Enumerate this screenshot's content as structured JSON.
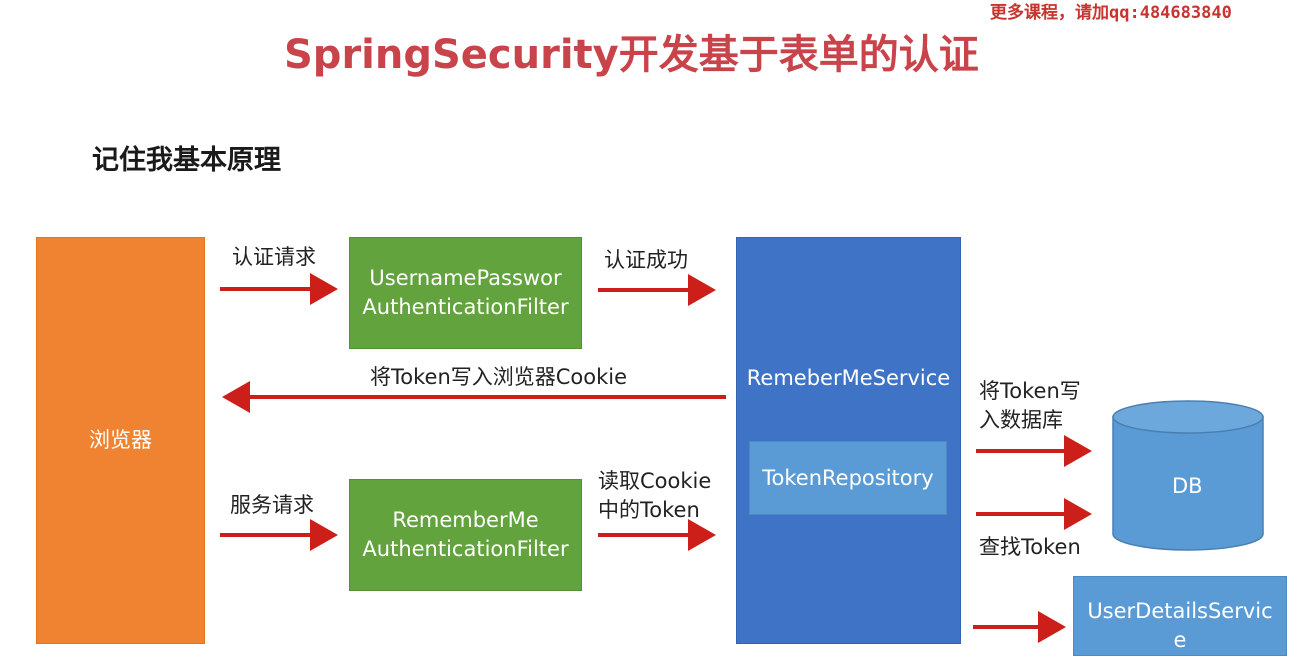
{
  "watermark": "更多课程，请加qq:484683840",
  "title": "SpringSecurity开发基于表单的认证",
  "subtitle": "记住我基本原理",
  "nodes": {
    "browser": "浏览器",
    "upaf_line1": "UsernamePasswor",
    "upaf_line2": "AuthenticationFilter",
    "rmaf_line1": "RememberMe",
    "rmaf_line2": "AuthenticationFilter",
    "rms": "RemeberMeService",
    "token_repo": "TokenRepository",
    "db": "DB",
    "uds_line1": "UserDetailsServic",
    "uds_line2": "e"
  },
  "edges": {
    "auth_request": "认证请求",
    "auth_success": "认证成功",
    "write_cookie": "将Token写入浏览器Cookie",
    "service_request": "服务请求",
    "read_cookie_line1": "读取Cookie",
    "read_cookie_line2": "中的Token",
    "write_db_line1": "将Token写",
    "write_db_line2": "入数据库",
    "find_token": "查找Token"
  },
  "colors": {
    "title": "#c9444a",
    "arrow": "#cc1f1a",
    "browser": "#f08331",
    "filter": "#62a33e",
    "service": "#3f73c6",
    "db": "#5b9bd5"
  }
}
